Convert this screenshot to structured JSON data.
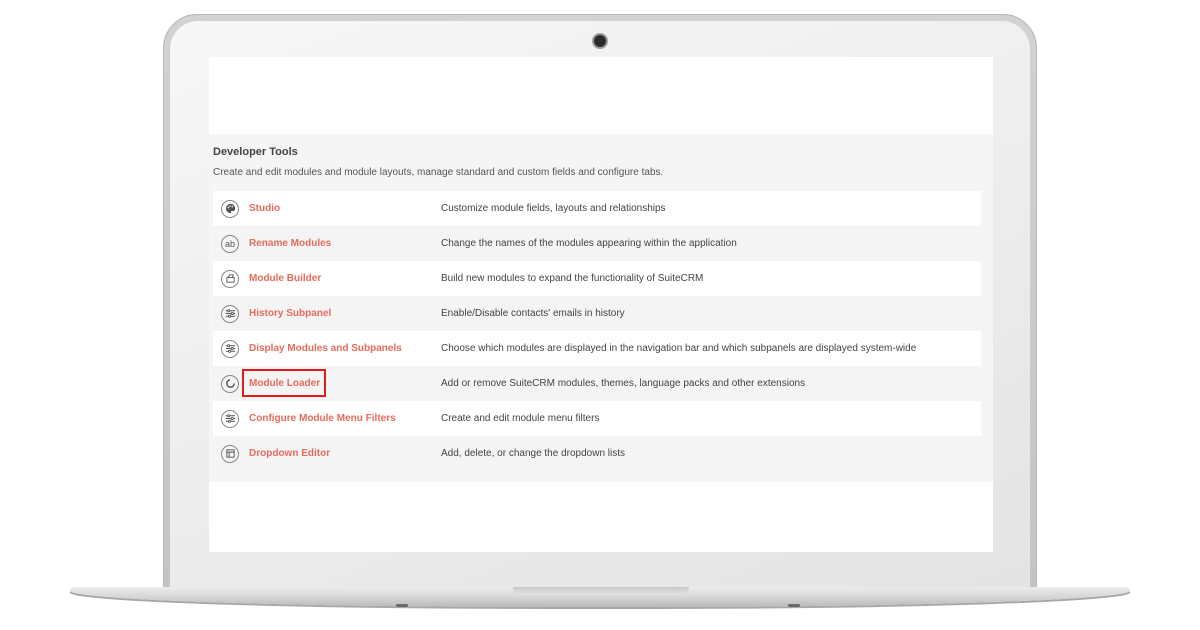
{
  "panel": {
    "title": "Developer Tools",
    "description": "Create and edit modules and module layouts, manage standard and custom fields and configure tabs."
  },
  "tools": [
    {
      "label": "Studio",
      "description": "Customize module fields, layouts and relationships",
      "icon": "palette-icon",
      "highlighted": false
    },
    {
      "label": "Rename Modules",
      "description": "Change the names of the modules appearing within the application",
      "icon": "ab-text-icon",
      "highlighted": false
    },
    {
      "label": "Module Builder",
      "description": "Build new modules to expand the functionality of SuiteCRM",
      "icon": "builder-icon",
      "highlighted": false
    },
    {
      "label": "History Subpanel",
      "description": "Enable/Disable contacts' emails in history",
      "icon": "sliders-icon",
      "highlighted": false
    },
    {
      "label": "Display Modules and Subpanels",
      "description": "Choose which modules are displayed in the navigation bar and which subpanels are displayed system-wide",
      "icon": "sliders-icon",
      "highlighted": false
    },
    {
      "label": "Module Loader",
      "description": "Add or remove SuiteCRM modules, themes, language packs and other extensions",
      "icon": "loader-icon",
      "highlighted": true
    },
    {
      "label": "Configure Module Menu Filters",
      "description": "Create and edit module menu filters",
      "icon": "sliders-icon",
      "highlighted": false
    },
    {
      "label": "Dropdown Editor",
      "description": "Add, delete, or change the dropdown lists",
      "icon": "dropdown-list-icon",
      "highlighted": false
    }
  ],
  "colors": {
    "link": "#e86b5c",
    "highlight_box": "#e21a1a",
    "row_alt": "#f4f4f4",
    "panel_bg": "#f5f5f5"
  }
}
